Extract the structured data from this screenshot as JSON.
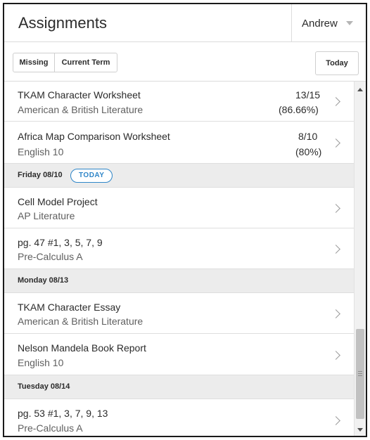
{
  "header": {
    "title": "Assignments",
    "user": "Andrew"
  },
  "toolbar": {
    "missing_label": "Missing",
    "current_term_label": "Current Term",
    "today_label": "Today"
  },
  "items": [
    {
      "name": "TKAM Character Worksheet",
      "course": "American & British Literature",
      "score": "13/15",
      "percent": "(86.66%)"
    },
    {
      "name": "Africa Map Comparison Worksheet",
      "course": "English 10",
      "score": "8/10",
      "percent": "(80%)"
    },
    {
      "name": "Cell Model Project",
      "course": "AP Literature"
    },
    {
      "name": "pg. 47 #1, 3, 5, 7, 9",
      "course": "Pre-Calculus A"
    },
    {
      "name": "TKAM Character Essay",
      "course": "American & British Literature"
    },
    {
      "name": "Nelson Mandela Book Report",
      "course": "English 10"
    },
    {
      "name": "pg. 53 #1, 3, 7, 9, 13",
      "course": "Pre-Calculus A"
    }
  ],
  "days": [
    {
      "label": "Friday 08/10",
      "badge": "TODAY"
    },
    {
      "label": "Monday 08/13"
    },
    {
      "label": "Tuesday 08/14"
    }
  ],
  "colors": {
    "accent": "#2f86c8",
    "day_header_bg": "#ececec",
    "border": "#dedede"
  },
  "icons": {
    "user_dropdown": "caret-down-icon",
    "row_chevron": "chevron-right-icon"
  }
}
